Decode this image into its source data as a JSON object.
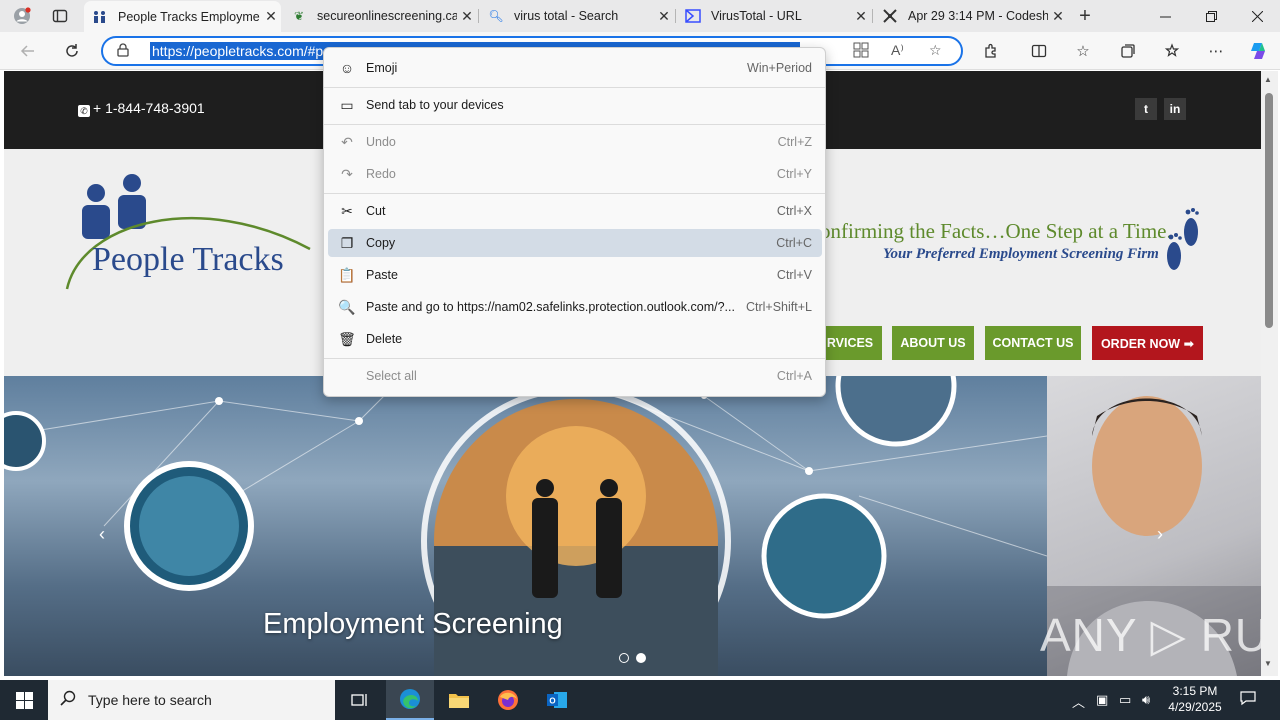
{
  "tabs": [
    {
      "title": "People Tracks Employme",
      "close": "✕",
      "active": true
    },
    {
      "title": "secureonlinescreening.ca",
      "close": "✕",
      "active": false
    },
    {
      "title": "virus total - Search",
      "close": "✕",
      "active": false
    },
    {
      "title": "VirusTotal - URL",
      "close": "✕",
      "active": false
    },
    {
      "title": "Apr 29 3:14 PM - Codesh",
      "close": "✕",
      "active": false
    }
  ],
  "new_tab_label": "+",
  "address": {
    "url": "https://peopletracks.com/#p"
  },
  "site": {
    "phone": "+ 1-844-748-3901",
    "social": [
      "t",
      "in"
    ],
    "logo_text": "People Tracks",
    "tagline_1": "onfirming the Facts…One Step at a Time.",
    "tagline_2": "Your Preferred Employment Screening Firm",
    "nav": [
      {
        "label": "RVICES"
      },
      {
        "label": "ABOUT US"
      },
      {
        "label": "CONTACT US"
      },
      {
        "label": "ORDER NOW ➡"
      }
    ],
    "hero_title": "Employment Screening",
    "watermark": "ANY ▷ RUN"
  },
  "context_menu": [
    {
      "label": "Emoji",
      "shortcut": "Win+Period",
      "icon": "☺",
      "disabled": false,
      "highlight": false
    },
    {
      "label": "Send tab to your devices",
      "shortcut": "",
      "icon": "▭",
      "disabled": false,
      "highlight": false
    },
    {
      "label": "Undo",
      "shortcut": "Ctrl+Z",
      "icon": "↶",
      "disabled": true,
      "highlight": false
    },
    {
      "label": "Redo",
      "shortcut": "Ctrl+Y",
      "icon": "↷",
      "disabled": true,
      "highlight": false
    },
    {
      "label": "Cut",
      "shortcut": "Ctrl+X",
      "icon": "✂",
      "disabled": false,
      "highlight": false
    },
    {
      "label": "Copy",
      "shortcut": "Ctrl+C",
      "icon": "❐",
      "disabled": false,
      "highlight": true
    },
    {
      "label": "Paste",
      "shortcut": "Ctrl+V",
      "icon": "📋",
      "disabled": false,
      "highlight": false
    },
    {
      "label": "Paste and go to https://nam02.safelinks.protection.outlook.com/?...",
      "shortcut": "Ctrl+Shift+L",
      "icon": "🔍",
      "disabled": false,
      "highlight": false
    },
    {
      "label": "Delete",
      "shortcut": "",
      "icon": "🗑",
      "disabled": false,
      "highlight": false
    },
    {
      "label": "Select all",
      "shortcut": "Ctrl+A",
      "icon": "",
      "disabled": true,
      "highlight": false
    }
  ],
  "taskbar": {
    "search_placeholder": "Type here to search",
    "time": "3:15 PM",
    "date": "4/29/2025"
  },
  "colors": {
    "accent": "#1a73e8",
    "nav_green": "#6a9a2c",
    "nav_red": "#b3161d",
    "logo_blue": "#2a4a8c",
    "taskbar": "#1f2933"
  }
}
